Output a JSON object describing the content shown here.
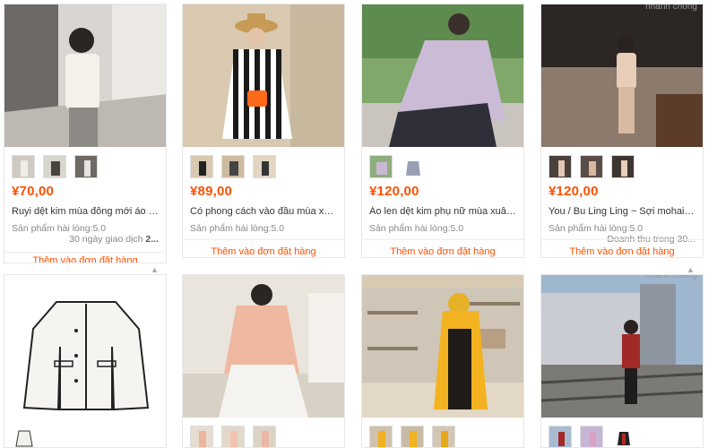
{
  "watermark": "nhanh chóng",
  "cart_label": "Thêm vào đơn đặt hàng",
  "row1": [
    {
      "price": "¥70,00",
      "title": "Ruyi dệt kim mùa đông mới áo khoác...",
      "satisfaction": "Sản phẩm hài lòng:5.0",
      "deal_prefix": "30 ngày giao dịch ",
      "deal_num": "2..."
    },
    {
      "price": "¥89,00",
      "title": "Có phong cách vào đầu mùa xuân! Á...",
      "satisfaction": "Sản phẩm hài lòng:5.0",
      "deal_prefix": "",
      "deal_num": ""
    },
    {
      "price": "¥120,00",
      "title": "Áo len dệt kim phụ nữ mùa xuân pho...",
      "satisfaction": "Sản phẩm hài lòng:5.0",
      "deal_prefix": "",
      "deal_num": ""
    },
    {
      "price": "¥120,00",
      "title": "You / Bu Ling Ling ~ Sợi mohair áo le...",
      "satisfaction": "Sản phẩm hài lòng:5.0",
      "deal_prefix": "Doanh thu trong 30...",
      "deal_num": ""
    }
  ],
  "colors": {
    "accent": "#ff5000",
    "border": "#e8e8e8"
  },
  "icons": [
    "product-photo",
    "variant-thumbnail",
    "collapse-arrow-icon"
  ]
}
